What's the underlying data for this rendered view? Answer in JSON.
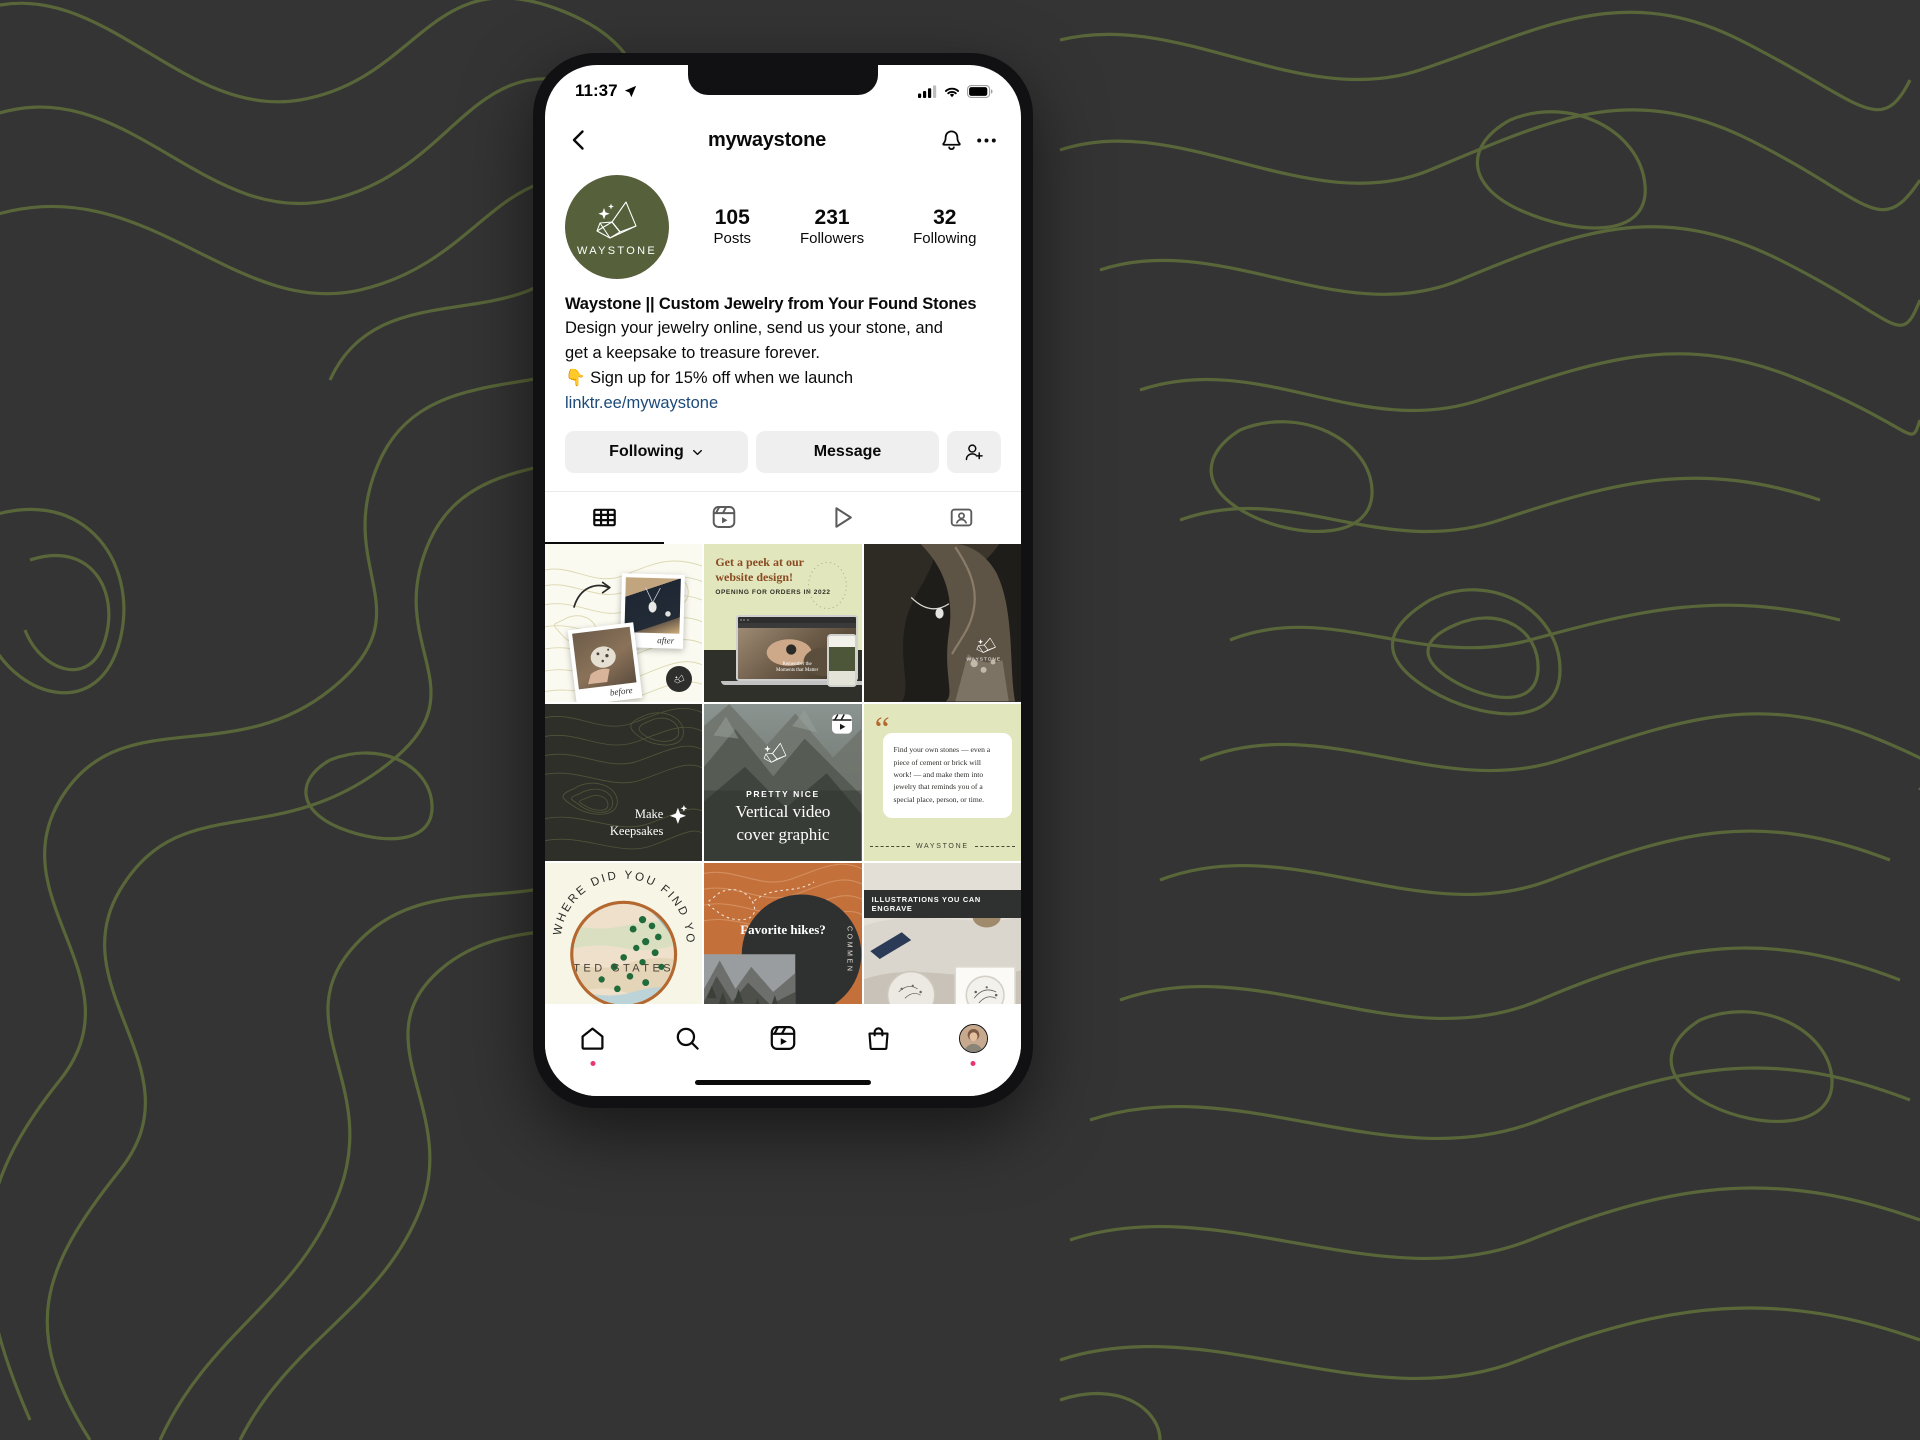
{
  "page": {
    "background_color": "#343434",
    "topo_line_color": "#5d6b3a"
  },
  "status_bar": {
    "time": "11:37",
    "location_icon": "location-arrow-icon",
    "signal_icon": "cellular-signal-icon",
    "wifi_icon": "wifi-icon",
    "battery_icon": "battery-icon"
  },
  "nav": {
    "back_icon": "chevron-left-icon",
    "title": "mywaystone",
    "notifications_icon": "bell-icon",
    "more_icon": "ellipsis-icon"
  },
  "profile": {
    "avatar_name": "waystone-avatar",
    "avatar_wordmark": "WAYSTONE",
    "avatar_bg": "#56603a",
    "stats": [
      {
        "value": "105",
        "label": "Posts"
      },
      {
        "value": "231",
        "label": "Followers"
      },
      {
        "value": "32",
        "label": "Following"
      }
    ],
    "bio_name": "Waystone || Custom Jewelry from Your Found Stones",
    "bio_text": "Design your jewelry online, send us your stone, and\nget a keepsake to treasure forever.",
    "bio_cta_emoji": "👇",
    "bio_cta": "Sign up for 15% off when we launch",
    "link": "linktr.ee/mywaystone",
    "link_color": "#1c4a7a"
  },
  "actions": {
    "following_label": "Following",
    "following_chevron": "chevron-down-icon",
    "message_label": "Message",
    "discover_icon": "add-person-icon"
  },
  "tabs": [
    {
      "name": "grid",
      "icon": "grid-icon",
      "active": true
    },
    {
      "name": "reels",
      "icon": "reels-icon",
      "active": false
    },
    {
      "name": "video",
      "icon": "play-triangle-icon",
      "active": false
    },
    {
      "name": "tagged",
      "icon": "tagged-person-icon",
      "active": false
    }
  ],
  "grid_posts": [
    {
      "name": "post-before-after-polaroids",
      "kind": "image",
      "caption_before": "before",
      "caption_after": "after",
      "badge": null
    },
    {
      "name": "post-website-design",
      "kind": "carousel",
      "heading_line1": "Get a peek at our",
      "heading_line2": "website design!",
      "subhead": "OPENING FOR ORDERS IN 2022",
      "mock_overlay_line1": "Remember the",
      "mock_overlay_line2": "Moments that Matter",
      "badge": null
    },
    {
      "name": "post-model-necklace",
      "kind": "image",
      "wordmark": "WAYSTONE",
      "badge": null
    },
    {
      "name": "post-make-keepsakes",
      "kind": "image",
      "line1": "Make",
      "line2": "Keepsakes",
      "badge": null
    },
    {
      "name": "post-vertical-video-cover",
      "kind": "reel",
      "kicker": "PRETTY NICE",
      "title_line1": "Vertical video",
      "title_line2": "cover graphic",
      "badge": "reels-icon"
    },
    {
      "name": "post-quote-card",
      "kind": "image",
      "quote": "Find your own stones — even a piece of cement or brick will work! — and make them into jewelry that reminds you of a special place, person, or time.",
      "footer_wordmark": "WAYSTONE",
      "badge": null
    },
    {
      "name": "post-where-did-you-find-your-stone",
      "kind": "image",
      "ring_text": "WHERE DID YOU FIND YOUR STONE?",
      "map_label": "TED STATES",
      "badge": null
    },
    {
      "name": "post-favorite-hikes",
      "kind": "image",
      "title": "Favorite hikes?",
      "side_text": "COMMEN",
      "badge": null
    },
    {
      "name": "post-illustrations-engrave",
      "kind": "image",
      "band_text": "ILLUSTRATIONS YOU CAN ENGRAVE",
      "badge": null
    }
  ],
  "bottom_nav": [
    {
      "name": "home",
      "icon": "home-icon",
      "dot": true
    },
    {
      "name": "search",
      "icon": "search-icon",
      "dot": false
    },
    {
      "name": "reels",
      "icon": "reels-icon",
      "dot": false
    },
    {
      "name": "shop",
      "icon": "shopping-bag-icon",
      "dot": false
    },
    {
      "name": "profile",
      "icon": "profile-avatar-icon",
      "dot": true
    }
  ]
}
